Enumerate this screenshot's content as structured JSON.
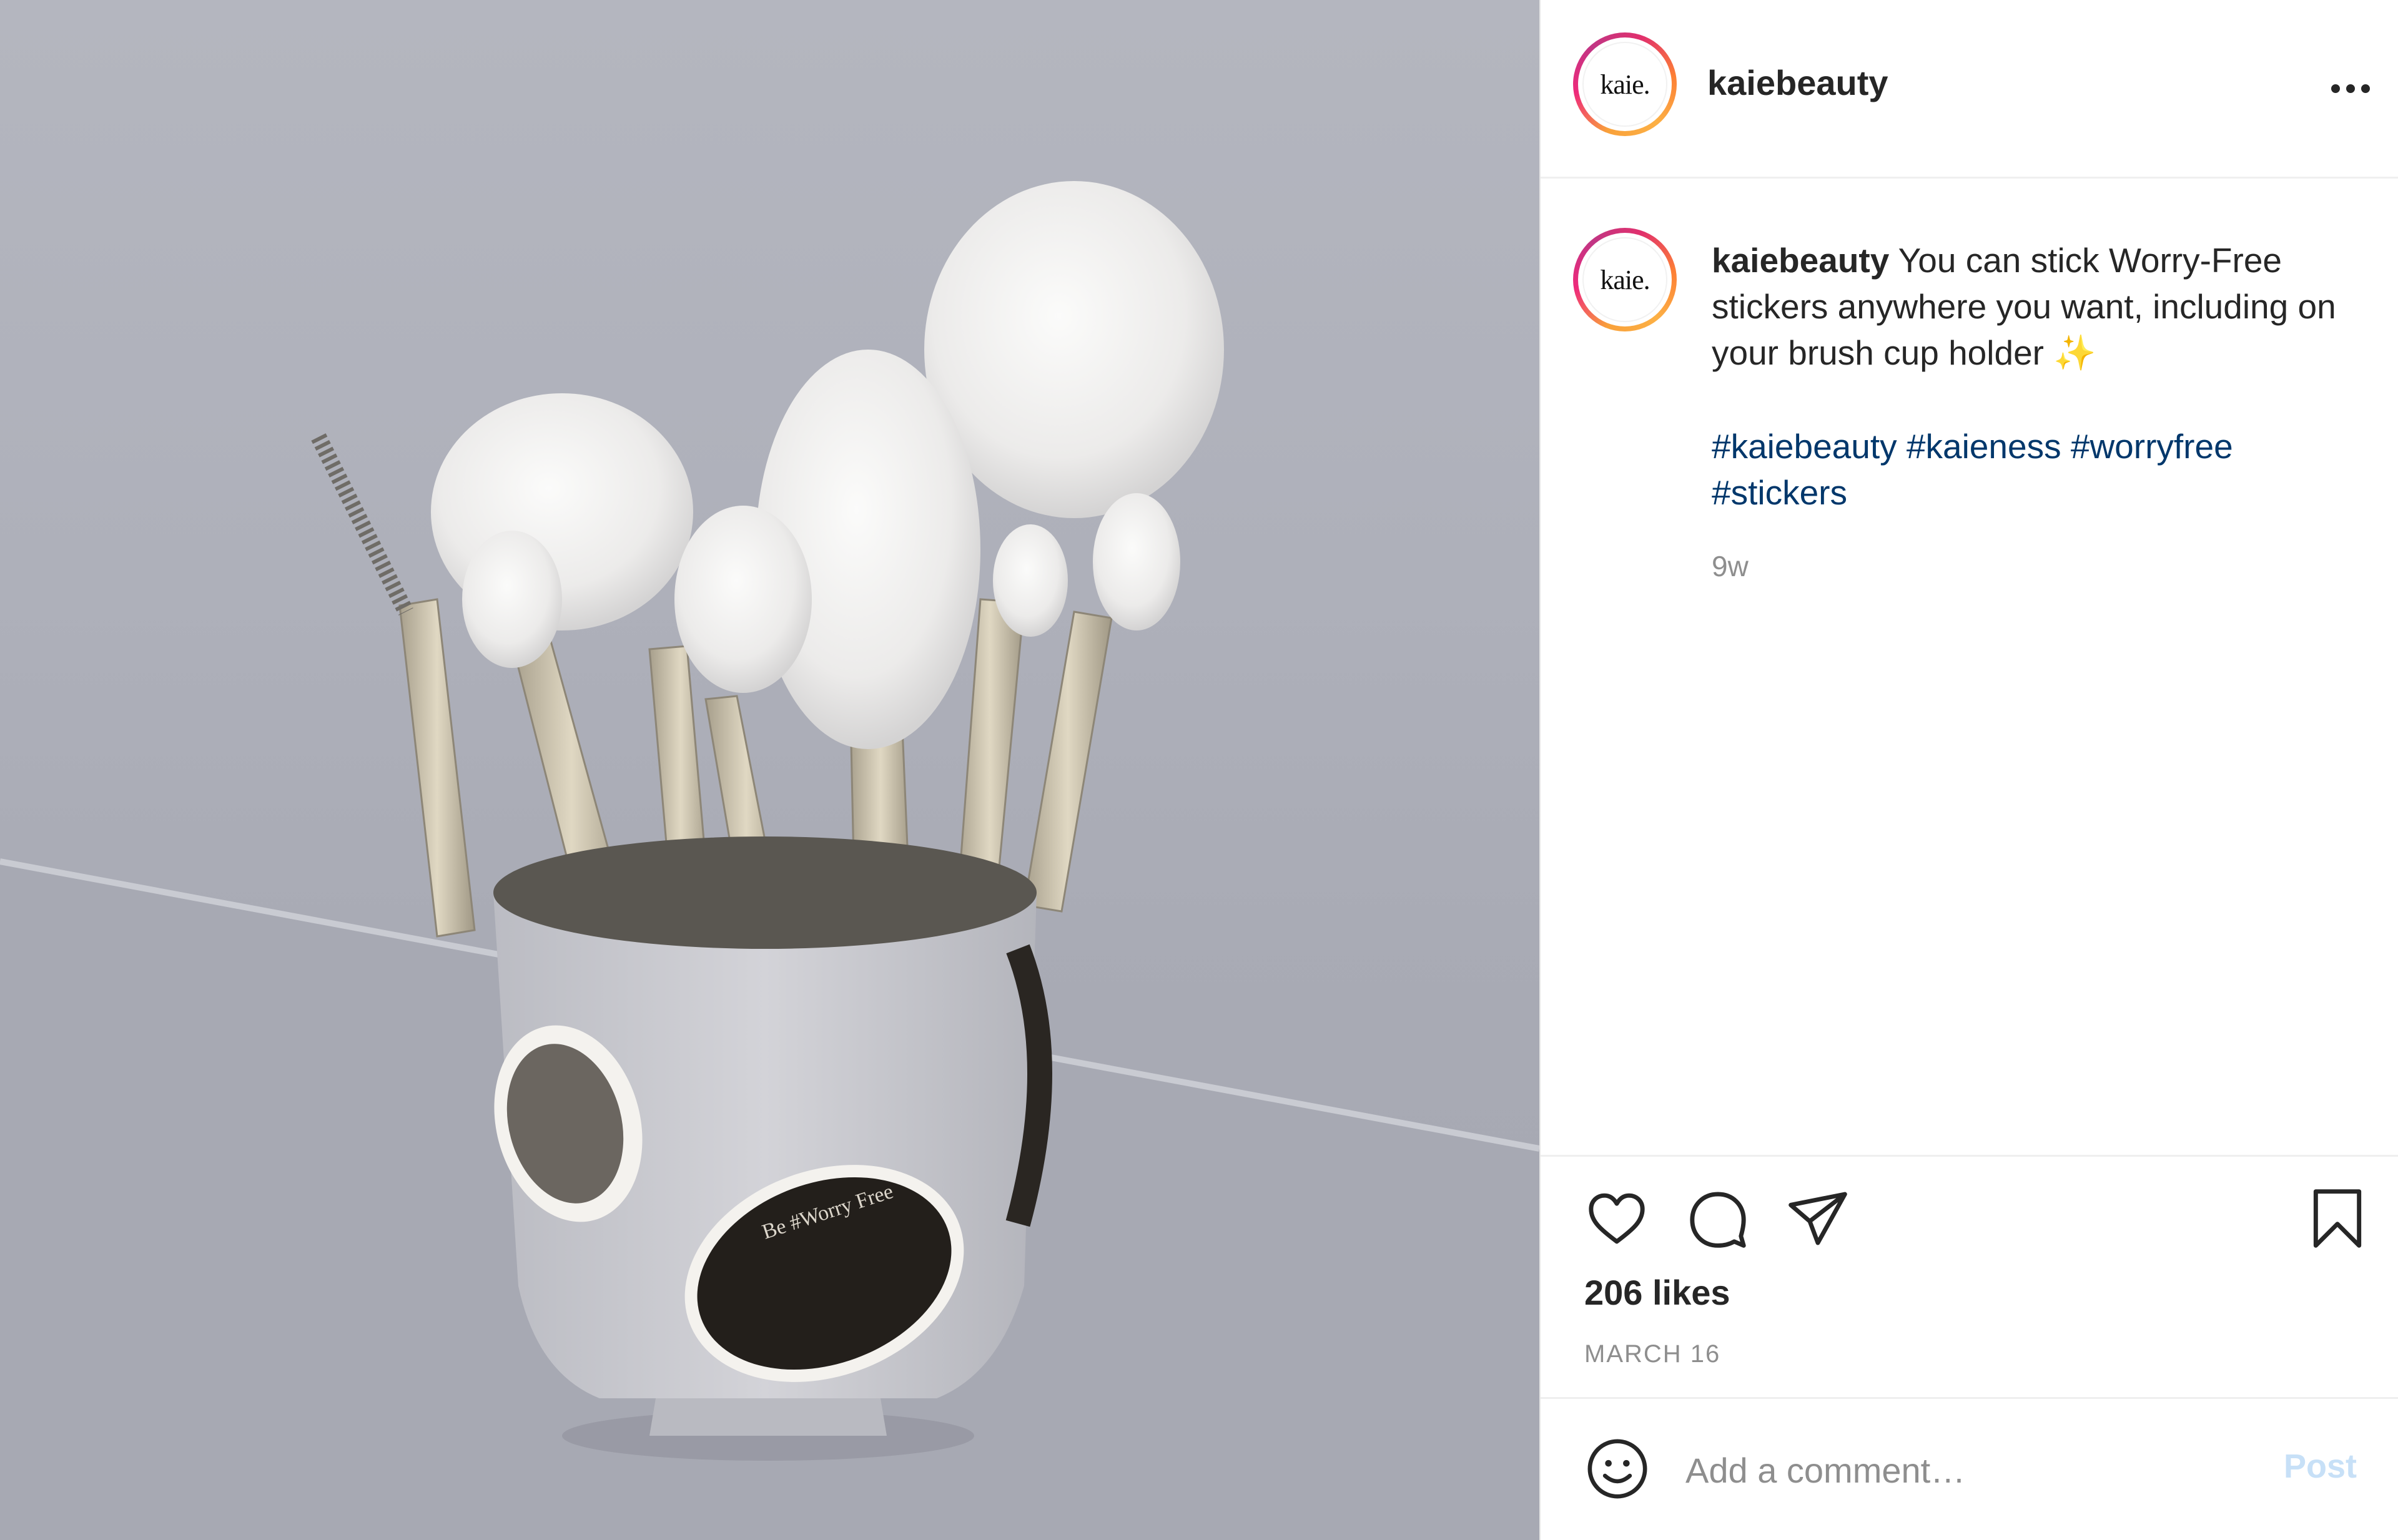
{
  "post": {
    "photo_sticker_text": "Be #Worry Free",
    "account": {
      "username": "kaiebeauty",
      "avatar_text": "kaie."
    },
    "caption": {
      "username": "kaiebeauty",
      "text": "You can stick Worry-Free stickers anywhere you want, including on your brush cup holder",
      "emoji": "✨",
      "hashtags": [
        "#kaiebeauty",
        "#kaieness",
        "#worryfree",
        "#stickers"
      ]
    },
    "age": "9w",
    "likes": "206 likes",
    "date": "MARCH 16",
    "comment": {
      "placeholder": "Add a comment…",
      "post_label": "Post"
    },
    "icons": {
      "more": "more-options-icon",
      "like": "heart-icon",
      "comment": "comment-icon",
      "share": "share-icon",
      "save": "bookmark-icon",
      "emoji": "emoji-icon"
    }
  }
}
